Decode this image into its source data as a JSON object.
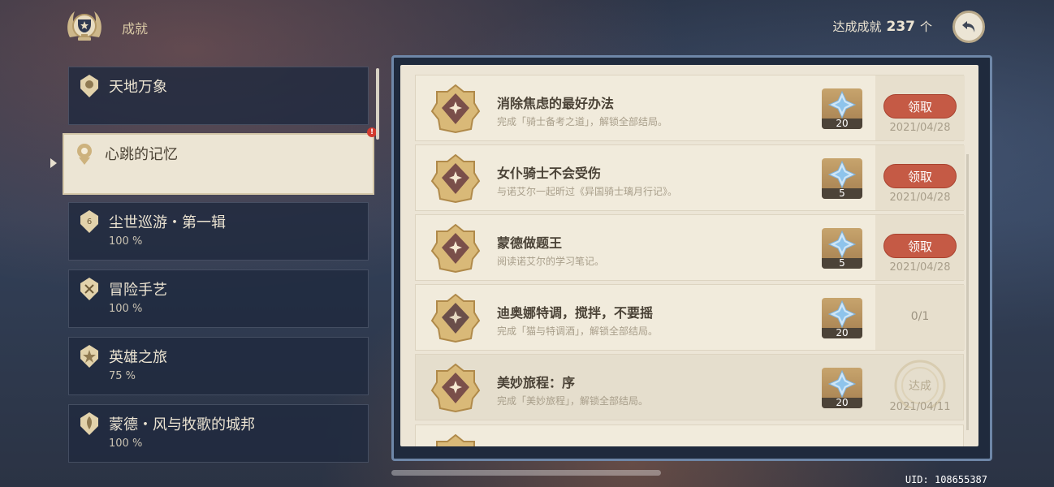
{
  "header": {
    "title": "成就",
    "count_label": "达成成就",
    "count_value": "237",
    "count_unit": "个"
  },
  "sidebar": {
    "items": [
      {
        "name": "天地万象",
        "percent": ""
      },
      {
        "name": "心跳的记忆",
        "percent": "",
        "alert": "!"
      },
      {
        "name": "尘世巡游・第一辑",
        "percent": "100 %"
      },
      {
        "name": "冒险手艺",
        "percent": "100 %"
      },
      {
        "name": "英雄之旅",
        "percent": "75 %"
      },
      {
        "name": "蒙德・风与牧歌的城邦",
        "percent": "100 %"
      }
    ]
  },
  "achievements": [
    {
      "title": "消除焦虑的最好办法",
      "desc": "完成「骑士备考之道」，解锁全部结局。",
      "reward": "20",
      "status": "claim",
      "claim_label": "领取",
      "date": "2021/04/28"
    },
    {
      "title": "女仆骑士不会受伤",
      "desc": "与诺艾尔一起昕过《异国骑士璃月行记》。",
      "reward": "5",
      "status": "claim",
      "claim_label": "领取",
      "date": "2021/04/28"
    },
    {
      "title": "蒙德做题王",
      "desc": "阅读诺艾尔的学习笔记。",
      "reward": "5",
      "status": "claim",
      "claim_label": "领取",
      "date": "2021/04/28"
    },
    {
      "title": "迪奥娜特调，搅拌，不要摇",
      "desc": "完成「猫与特调酒」，解锁全部结局。",
      "reward": "20",
      "status": "progress",
      "progress": "0/1"
    },
    {
      "title": "美妙旅程：序",
      "desc": "完成「美妙旅程」，解锁全部结局。",
      "reward": "20",
      "status": "done",
      "done_label": "达成",
      "date": "2021/04/11"
    }
  ],
  "footer": {
    "uid": "UID: 108655387"
  },
  "colors": {
    "claim_button": "#c55a45",
    "panel_bg": "#ece5d6",
    "gold": "#c9a35e"
  }
}
